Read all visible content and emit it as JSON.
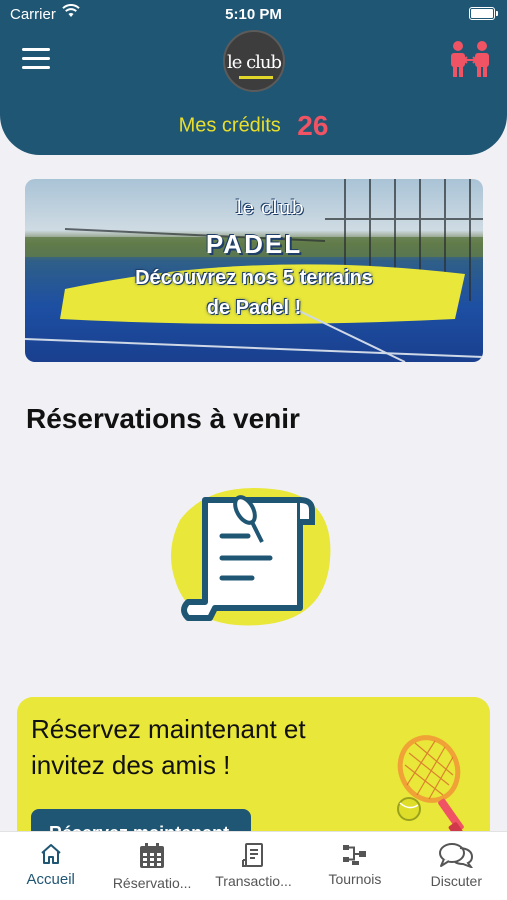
{
  "status_bar": {
    "carrier": "Carrier",
    "time": "5:10 PM"
  },
  "header": {
    "logo_text": "le club",
    "credits_label": "Mes crédits",
    "credits_value": "26"
  },
  "banner": {
    "logo_text": "le club",
    "title": "PADEL",
    "line1": "Découvrez nos 5 terrains",
    "line2": "de Padel !"
  },
  "section": {
    "title": "Réservations à venir"
  },
  "cta": {
    "title": "Réservez maintenant et invitez des amis !",
    "button_label": "Réservez maintenant"
  },
  "nav": {
    "items": [
      {
        "label": "Accueil",
        "icon": "home-icon",
        "active": true
      },
      {
        "label": "Réservatio...",
        "icon": "calendar-icon"
      },
      {
        "label": "Transactio...",
        "icon": "receipt-icon"
      },
      {
        "label": "Tournois",
        "icon": "bracket-icon"
      },
      {
        "label": "Discuter",
        "icon": "chat-icon"
      }
    ]
  },
  "colors": {
    "primary": "#1f5673",
    "accent_yellow": "#e9e739",
    "credits_red": "#f05363",
    "background": "#f1f1f5"
  }
}
